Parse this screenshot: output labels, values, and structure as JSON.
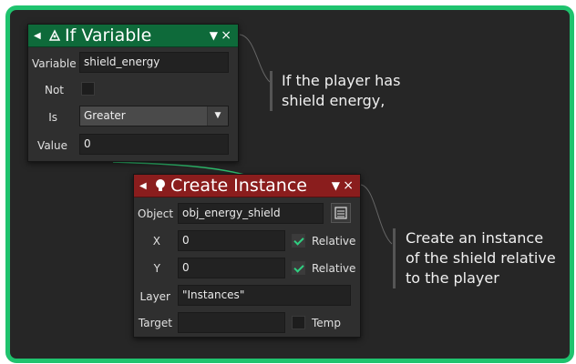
{
  "colors": {
    "frame_border": "#1fc36e",
    "background": "#262626",
    "if_variable_header": "#0e6a3a",
    "create_instance_header": "#8a1d1d",
    "connector": "#2fbf6f",
    "checkbox_check": "#2fd081"
  },
  "if_variable": {
    "title": "If Variable",
    "icon": "variable-flask-icon",
    "menu_icon": "▼",
    "close_icon": "×",
    "variable_label": "Variable",
    "variable_value": "shield_energy",
    "not_label": "Not",
    "not_checked": false,
    "is_label": "Is",
    "is_value": "Greater",
    "value_label": "Value",
    "value_value": "0"
  },
  "create_instance": {
    "title": "Create Instance",
    "icon": "lightbulb-icon",
    "menu_icon": "▼",
    "close_icon": "×",
    "object_label": "Object",
    "object_value": "obj_energy_shield",
    "x_label": "X",
    "x_value": "0",
    "x_relative_label": "Relative",
    "x_relative_checked": true,
    "y_label": "Y",
    "y_value": "0",
    "y_relative_label": "Relative",
    "y_relative_checked": true,
    "layer_label": "Layer",
    "layer_value": "\"Instances\"",
    "target_label": "Target",
    "target_value": "",
    "temp_label": "Temp",
    "temp_checked": false
  },
  "notes": {
    "note1_line1": "If the player has",
    "note1_line2": "shield energy,",
    "note2_line1": "Create an instance",
    "note2_line2": "of the shield relative",
    "note2_line3": "to the player"
  }
}
